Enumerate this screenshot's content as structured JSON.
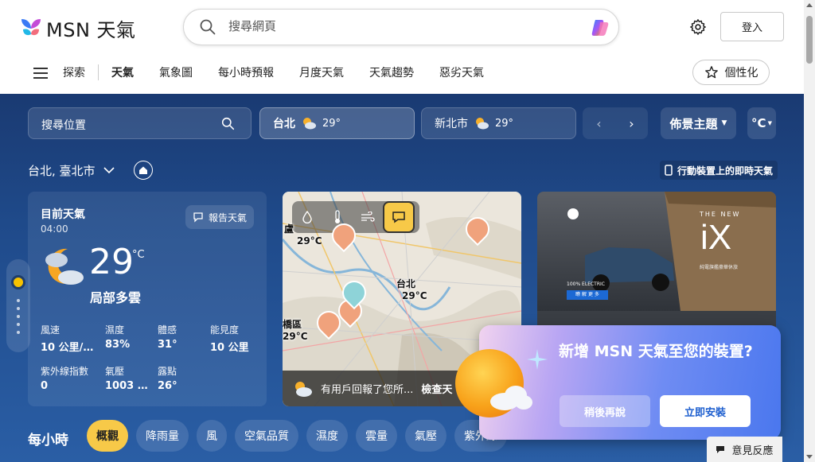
{
  "header": {
    "logo_text": "MSN 天氣",
    "search_placeholder": "搜尋網頁",
    "login_label": "登入"
  },
  "nav": {
    "items": [
      "探索",
      "天氣",
      "氣象圖",
      "每小時預報",
      "月度天氣",
      "天氣趨勢",
      "惡劣天氣"
    ],
    "active": "天氣",
    "personalize_label": "個性化"
  },
  "locations": {
    "search_label": "搜尋位置",
    "cities": [
      {
        "name": "台北",
        "temp": "29°",
        "selected": true
      },
      {
        "name": "新北市",
        "temp": "29°",
        "selected": false
      }
    ],
    "scene_label": "佈景主題",
    "unit_label": "°C"
  },
  "location_row": {
    "current_location": "台北, 臺北市",
    "mobile_link": "行動裝置上的即時天氣"
  },
  "current_weather": {
    "title": "目前天氣",
    "time": "04:00",
    "report_label": "報告天氣",
    "temperature": "29",
    "unit": "°C",
    "condition": "局部多雲",
    "stats": [
      {
        "label": "風速",
        "value": "10 公里/..."
      },
      {
        "label": "濕度",
        "value": "83%"
      },
      {
        "label": "體感",
        "value": "31°"
      },
      {
        "label": "能見度",
        "value": "10 公里"
      },
      {
        "label": "紫外線指數",
        "value": "0"
      },
      {
        "label": "氣壓",
        "value": "1003 ..."
      },
      {
        "label": "露點",
        "value": "26°"
      }
    ]
  },
  "map": {
    "labels": [
      {
        "text": "盧"
      },
      {
        "text": "29°C"
      },
      {
        "text": "台北"
      },
      {
        "text": "29°C"
      },
      {
        "text": "橋區"
      },
      {
        "text": "29°C"
      }
    ],
    "footer_text": "有用戶回報了您所...",
    "footer_action": "檢查天"
  },
  "ad": {
    "brand_text": "THE NEW",
    "model": "iX",
    "tagline": "100% ELECTRIC",
    "cta": "瞭 解 更 多",
    "subtitle": "純電旗艦豪華休旅"
  },
  "popup": {
    "title": "新增 MSN 天氣至您的裝置?",
    "later_label": "稍後再說",
    "install_label": "立即安裝"
  },
  "hourly": {
    "title": "每小時",
    "chips": [
      "概觀",
      "降雨量",
      "風",
      "空氣品質",
      "濕度",
      "雲量",
      "氣壓",
      "紫外線"
    ]
  },
  "feedback_label": "意見反應",
  "colors": {
    "accent_yellow": "#f7c948",
    "bg_blue": "#1f4a8a",
    "install_blue": "#1e5fcf"
  }
}
